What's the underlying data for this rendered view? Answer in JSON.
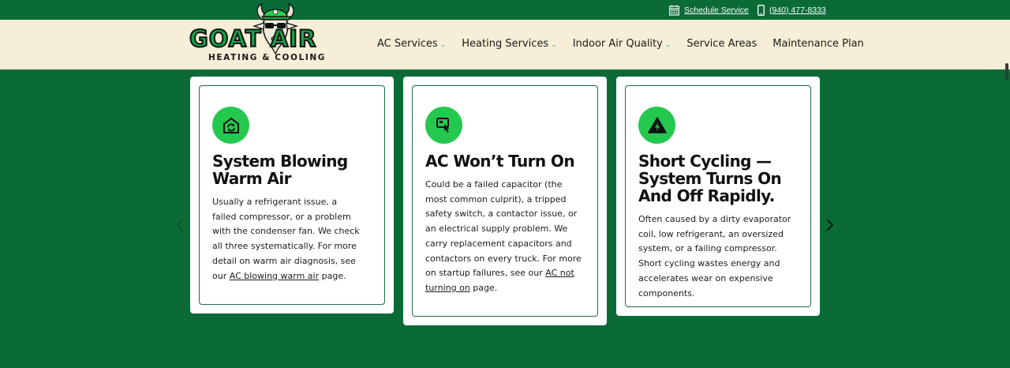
{
  "topbar": {
    "schedule_label": "Schedule Service",
    "phone_label": "(940) 477-8333"
  },
  "logo": {
    "wordmark": "GOAT AIR",
    "subtitle": "HEATING & COOLING"
  },
  "nav": {
    "items": [
      {
        "label": "AC Services",
        "has_dropdown": true
      },
      {
        "label": "Heating Services",
        "has_dropdown": true
      },
      {
        "label": "Indoor Air Quality",
        "has_dropdown": true
      },
      {
        "label": "Service Areas",
        "has_dropdown": false
      },
      {
        "label": "Maintenance Plan",
        "has_dropdown": false
      }
    ]
  },
  "cards": [
    {
      "icon": "house-refresh-icon",
      "title": "System Blowing Warm Air",
      "body_before": "Usually a refrigerant issue, a failed compressor, or a problem with the condenser fan. We check all three systematically. For more detail on warm air diagnosis, see our ",
      "link": "AC blowing warm air",
      "body_after": " page."
    },
    {
      "icon": "thermostat-touch-icon",
      "title": "AC Won’t Turn On",
      "body_before": "Could be a failed capacitor (the most common culprit), a tripped safety switch, a contactor issue, or an electrical supply problem. We carry replacement capacitors and contactors on every truck. For more on startup failures, see our ",
      "link": "AC not turning on",
      "body_after": " page."
    },
    {
      "icon": "warning-bolt-icon",
      "title": "Short Cycling — System Turns On And Off Rapidly.",
      "body_before": "Often caused by a dirty evaporator coil, low refrigerant, an oversized system, or a failing compressor. Short cycling wastes energy and accelerates wear on expensive components.",
      "link": "",
      "body_after": ""
    }
  ],
  "colors": {
    "brand_green": "#0a6b37",
    "header_cream": "#f6eed6",
    "icon_green": "#25c84e",
    "chevron_green": "#2eb85c"
  }
}
